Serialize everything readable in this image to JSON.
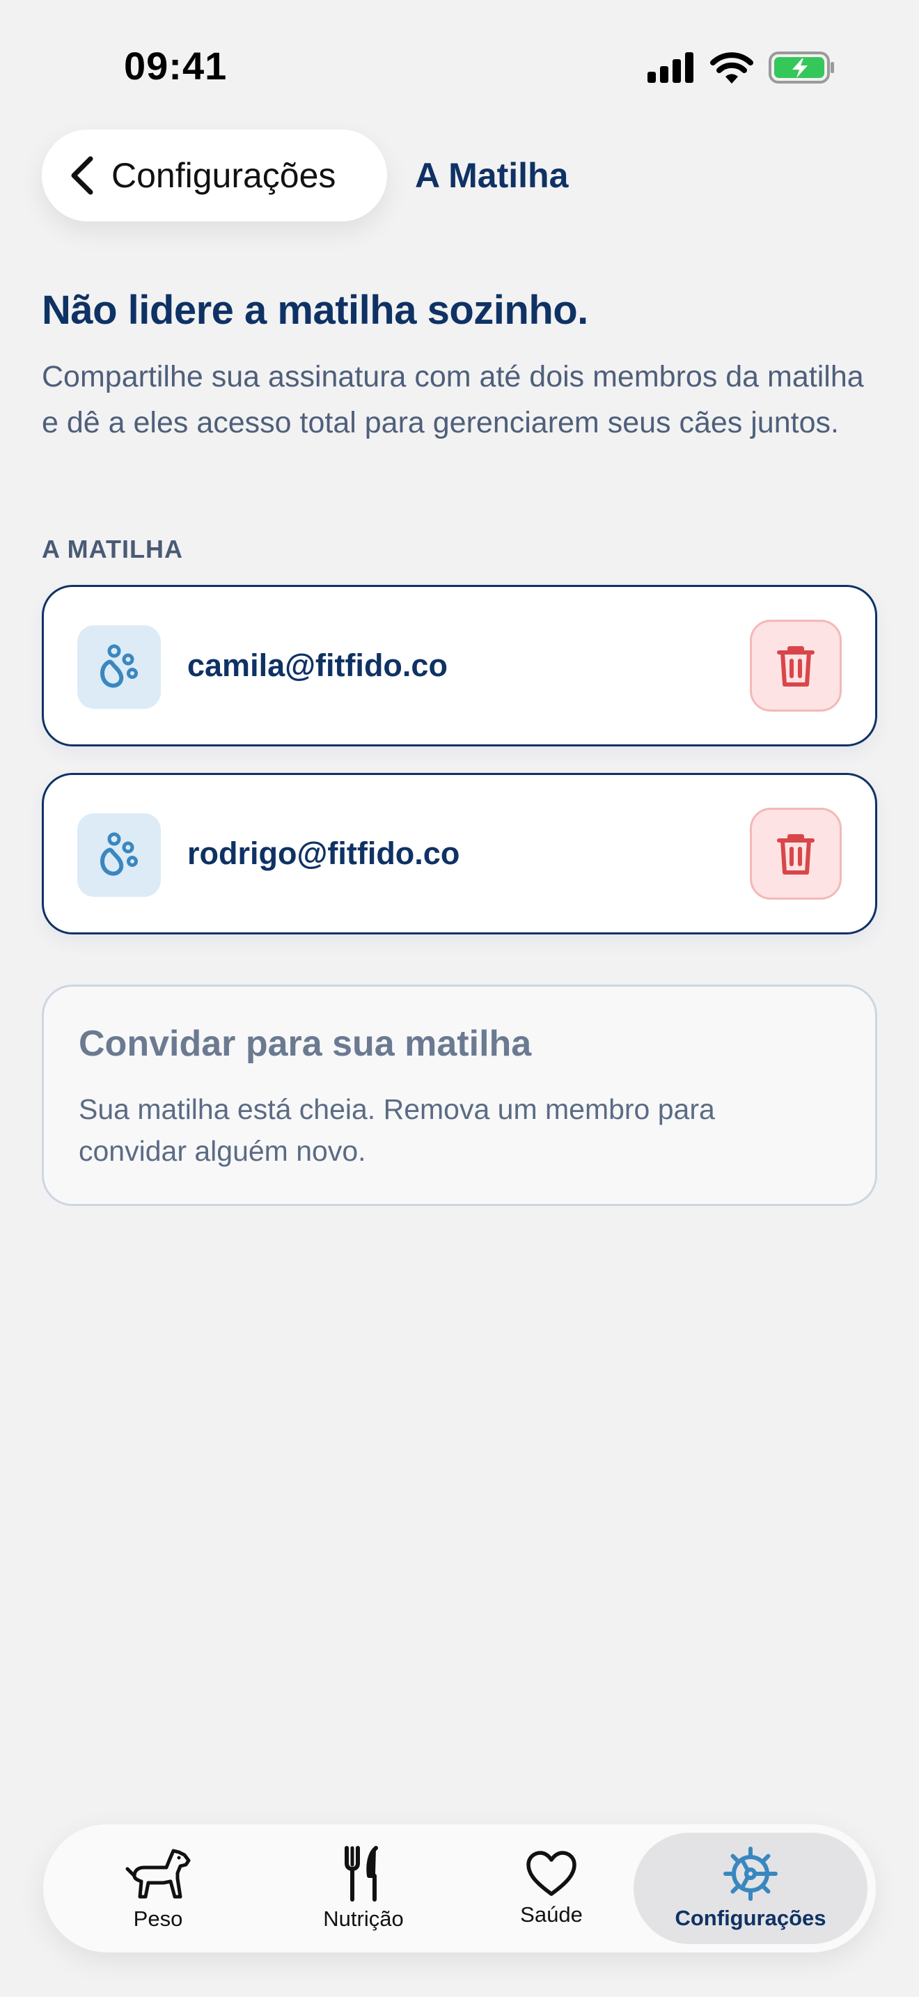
{
  "status_bar": {
    "time": "09:41"
  },
  "nav": {
    "back_label": "Configurações",
    "title": "A Matilha"
  },
  "intro": {
    "headline": "Não lidere a matilha sozinho.",
    "body": "Compartilhe sua assinatura com até dois membros da matilha e dê a eles acesso total para gerenciarem seus cães juntos."
  },
  "members": {
    "section_label": "A MATILHA",
    "items": [
      {
        "email": "camila@fitfido.co"
      },
      {
        "email": "rodrigo@fitfido.co"
      }
    ]
  },
  "invite": {
    "title": "Convidar para sua matilha",
    "text": "Sua matilha está cheia. Remova um membro para convidar alguém novo."
  },
  "tabbar": {
    "items": [
      {
        "label": "Peso",
        "icon": "dog-icon"
      },
      {
        "label": "Nutrição",
        "icon": "fork-knife-icon"
      },
      {
        "label": "Saúde",
        "icon": "heart-icon"
      },
      {
        "label": "Configurações",
        "icon": "gear-icon"
      }
    ],
    "active": "Configurações"
  },
  "colors": {
    "primary": "#0f3264",
    "accent": "#3a87c0",
    "danger": "#d9464a",
    "background": "#f2f2f3"
  }
}
